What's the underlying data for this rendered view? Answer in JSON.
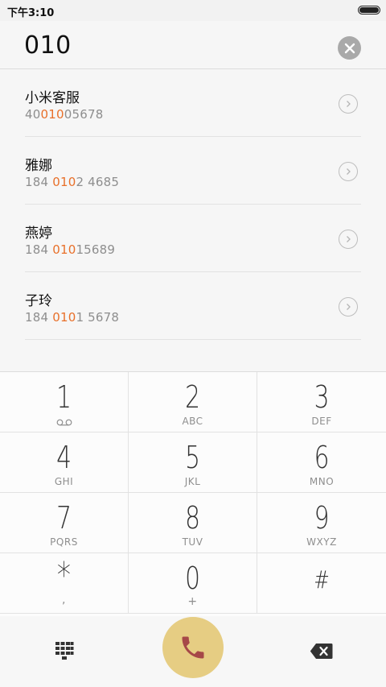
{
  "status_bar": {
    "time": "下午3:10"
  },
  "dial_input": {
    "value": "010"
  },
  "results": [
    {
      "name": "小米客服",
      "number_parts": [
        "40",
        "010",
        "05678"
      ]
    },
    {
      "name": "雅娜",
      "number_parts": [
        "184 ",
        "010",
        "2 4685"
      ]
    },
    {
      "name": "燕婷",
      "number_parts": [
        "184 ",
        "010",
        "15689"
      ]
    },
    {
      "name": "子玲",
      "number_parts": [
        "184 ",
        "010",
        "1 5678"
      ]
    }
  ],
  "keypad": {
    "keys": [
      {
        "digit": "1",
        "letters": ""
      },
      {
        "digit": "2",
        "letters": "ABC"
      },
      {
        "digit": "3",
        "letters": "DEF"
      },
      {
        "digit": "4",
        "letters": "GHI"
      },
      {
        "digit": "5",
        "letters": "JKL"
      },
      {
        "digit": "6",
        "letters": "MNO"
      },
      {
        "digit": "7",
        "letters": "PQRS"
      },
      {
        "digit": "8",
        "letters": "TUV"
      },
      {
        "digit": "9",
        "letters": "WXYZ"
      },
      {
        "digit": "*",
        "letters": ","
      },
      {
        "digit": "0",
        "letters": "+"
      },
      {
        "digit": "#",
        "letters": ""
      }
    ]
  },
  "icons": {
    "clear": "close-icon",
    "detail": "chevron-right-icon",
    "voicemail": "voicemail-icon",
    "dialpad": "dialpad-icon",
    "call": "phone-icon",
    "backspace": "backspace-icon"
  },
  "colors": {
    "highlight": "#e8702a",
    "call_button": "#e6cd83",
    "call_icon": "#a64848"
  }
}
